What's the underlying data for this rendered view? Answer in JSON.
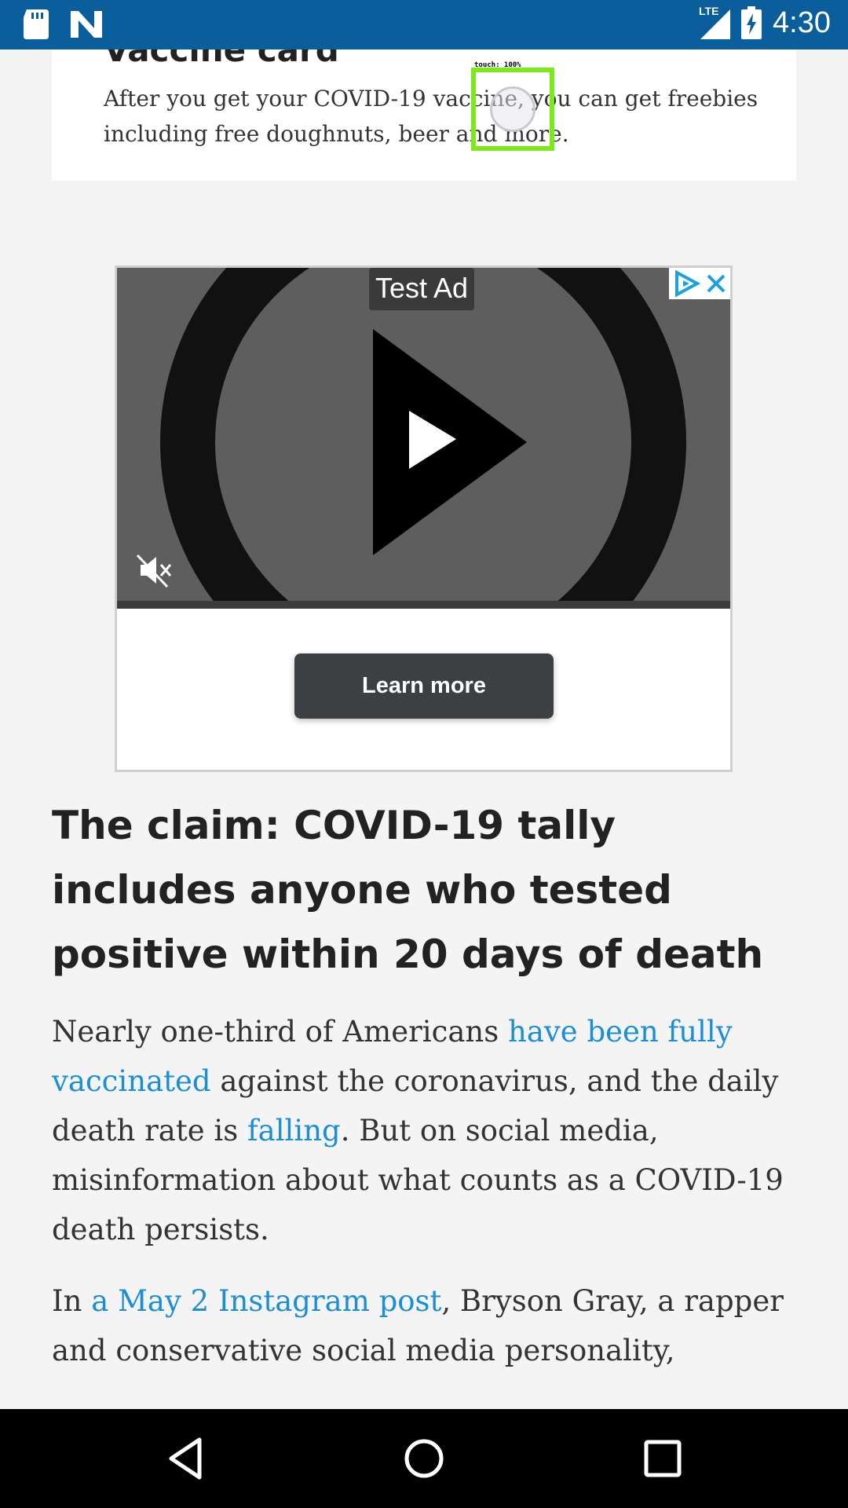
{
  "status_bar": {
    "time": "4:30",
    "network": "LTE",
    "icons": [
      "sd-card-icon",
      "n-notification-icon",
      "lte-signal-icon",
      "battery-charging-icon"
    ]
  },
  "article": {
    "card": {
      "title": "Vaccine card",
      "text": "After you get your COVID-19 vaccine, you can get freebies including free doughnuts, beer and more."
    },
    "ad": {
      "label": "Test Ad",
      "cta": "Learn more",
      "icons": [
        "adchoices-icon",
        "close-icon",
        "play-icon",
        "mute-icon"
      ]
    },
    "headline": "The claim: COVID-19 tally includes anyone who tested positive within 20 days of death",
    "paragraph1": {
      "t1": "Nearly one-third of Americans ",
      "link1": "have been fully vaccinated",
      "t2": " against the coronavirus, and the daily death rate is ",
      "link2": "falling",
      "t3": ". But on social media, misinformation about what counts as a COVID-19 death persists."
    },
    "paragraph2": {
      "t1": "In ",
      "link1": "a May 2 Instagram post",
      "t2": ", Bryson Gray, a rapper and conservative social media personality,"
    }
  },
  "touch_overlay": {
    "label": "touch: 100%"
  },
  "colors": {
    "status_bar": "#0a5e9c",
    "link": "#1a8ed6",
    "touch_box": "#7de81a",
    "cta_button": "#3c4043"
  },
  "nav_bar": {
    "icons": [
      "back-icon",
      "home-icon",
      "recents-icon"
    ]
  }
}
